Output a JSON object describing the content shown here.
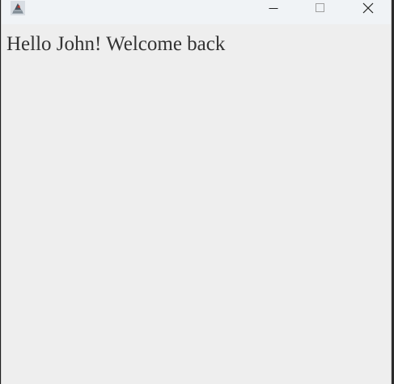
{
  "window": {
    "app_icon": "java-cup-icon",
    "controls": {
      "minimize_icon": "minimize-icon",
      "maximize_icon": "maximize-icon",
      "close_icon": "close-icon"
    }
  },
  "content": {
    "greeting": "Hello John! Welcome back"
  }
}
